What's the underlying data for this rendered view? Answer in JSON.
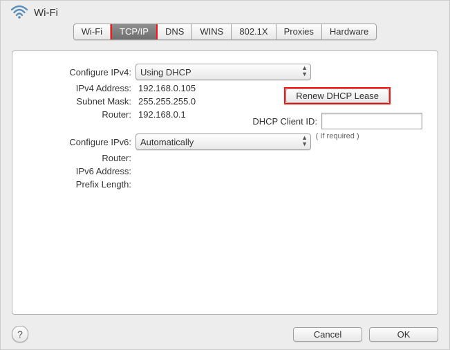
{
  "header": {
    "title": "Wi-Fi"
  },
  "tabs": [
    "Wi-Fi",
    "TCP/IP",
    "DNS",
    "WINS",
    "802.1X",
    "Proxies",
    "Hardware"
  ],
  "active_tab_index": 1,
  "ipv4": {
    "configure_label": "Configure IPv4:",
    "configure_value": "Using DHCP",
    "address_label": "IPv4 Address:",
    "address_value": "192.168.0.105",
    "subnet_label": "Subnet Mask:",
    "subnet_value": "255.255.255.0",
    "router_label": "Router:",
    "router_value": "192.168.0.1"
  },
  "dhcp": {
    "renew_label": "Renew DHCP Lease",
    "client_id_label": "DHCP Client ID:",
    "client_id_value": "",
    "if_required": "( If required )"
  },
  "ipv6": {
    "configure_label": "Configure IPv6:",
    "configure_value": "Automatically",
    "router_label": "Router:",
    "router_value": "",
    "address_label": "IPv6 Address:",
    "address_value": "",
    "prefix_label": "Prefix Length:",
    "prefix_value": ""
  },
  "footer": {
    "help": "?",
    "cancel": "Cancel",
    "ok": "OK"
  }
}
